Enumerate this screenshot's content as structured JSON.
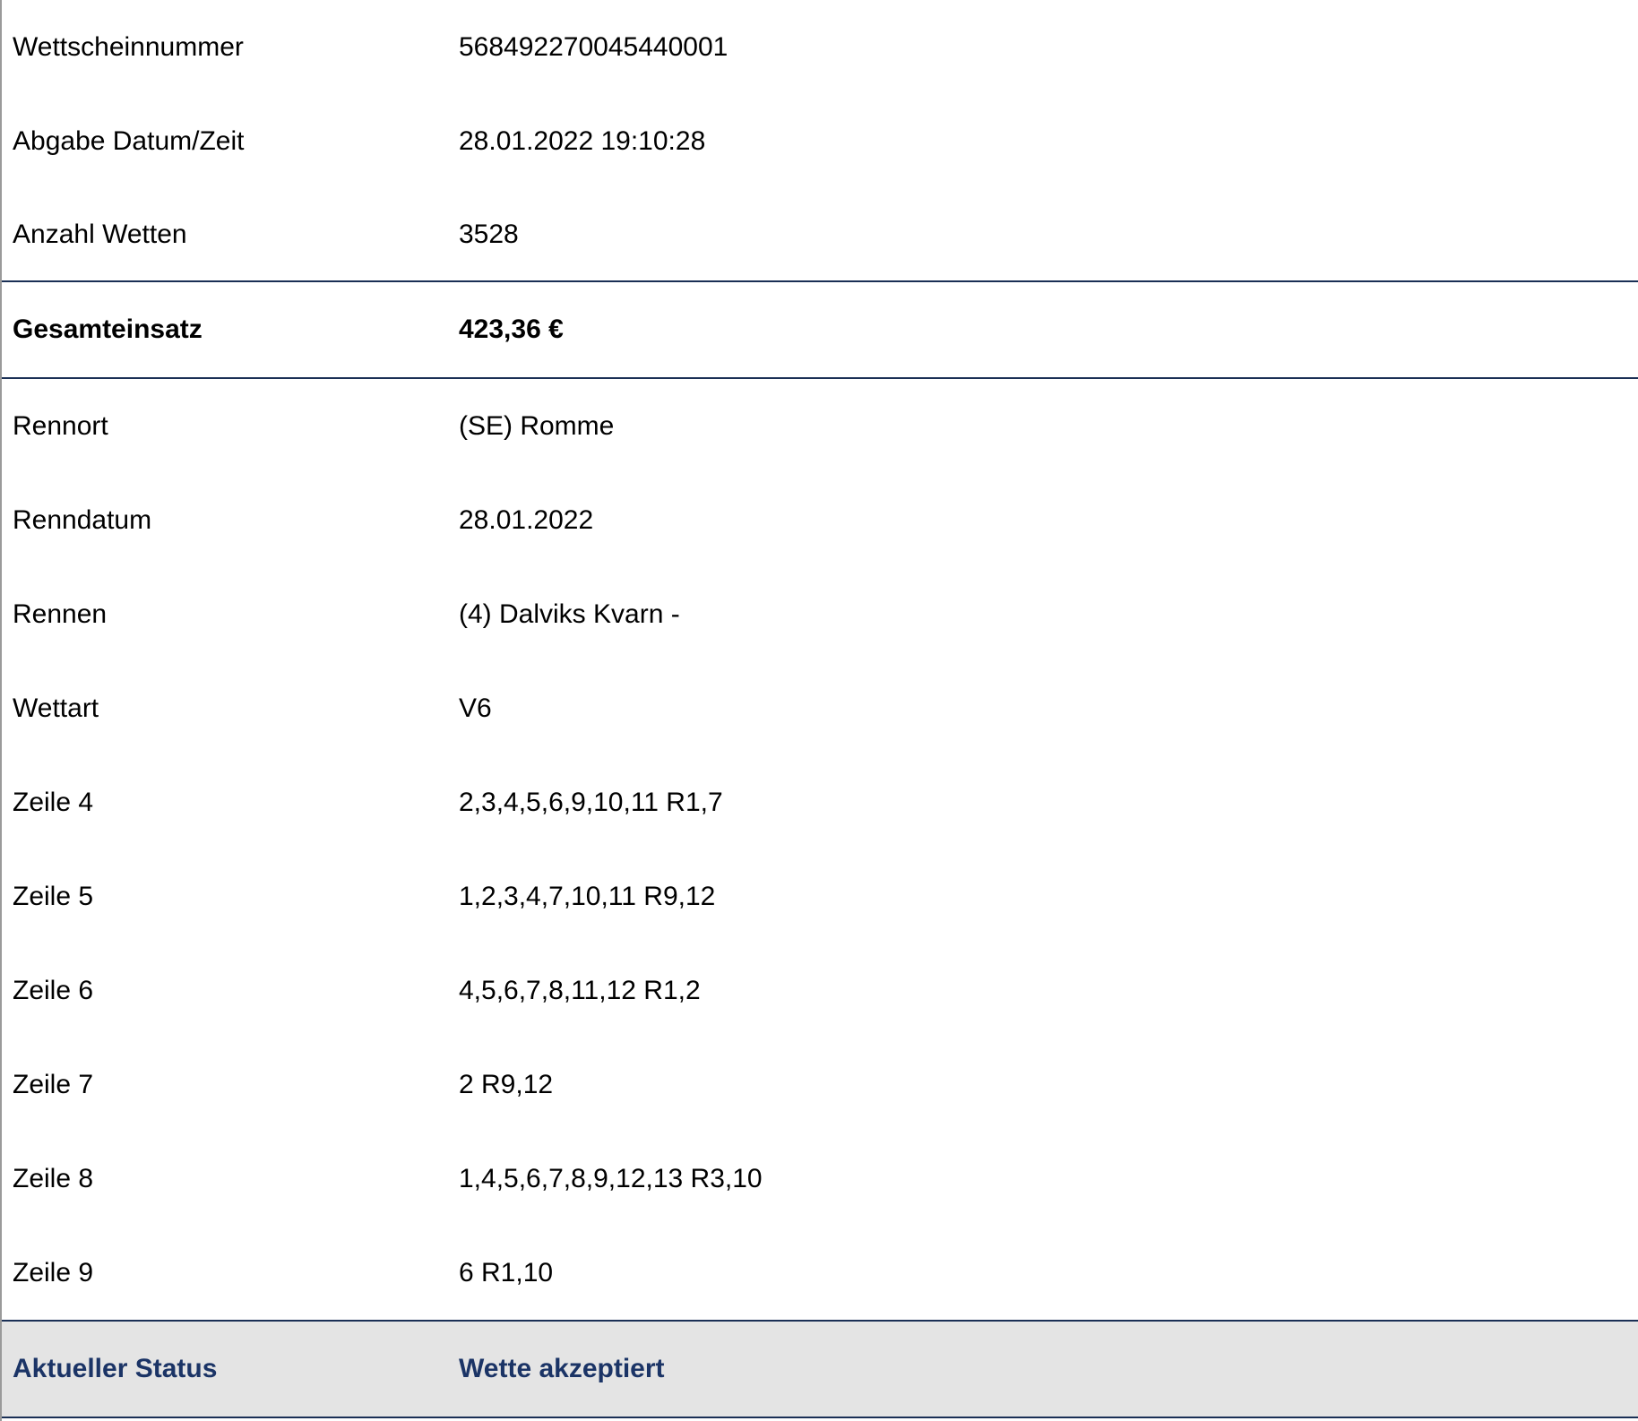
{
  "header_rows": [
    {
      "label": "Wettscheinnummer",
      "value": "568492270045440001"
    },
    {
      "label": "Abgabe Datum/Zeit",
      "value": "28.01.2022 19:10:28"
    },
    {
      "label": "Anzahl Wetten",
      "value": "3528"
    }
  ],
  "total": {
    "label": "Gesamteinsatz",
    "value": "423,36 €"
  },
  "detail_rows": [
    {
      "label": "Rennort",
      "value": "(SE) Romme"
    },
    {
      "label": "Renndatum",
      "value": "28.01.2022"
    },
    {
      "label": "Rennen",
      "value": "(4) Dalviks Kvarn -"
    },
    {
      "label": "Wettart",
      "value": "V6"
    },
    {
      "label": "Zeile 4",
      "value": "2,3,4,5,6,9,10,11 R1,7"
    },
    {
      "label": "Zeile 5",
      "value": "1,2,3,4,7,10,11 R9,12"
    },
    {
      "label": "Zeile 6",
      "value": "4,5,6,7,8,11,12 R1,2"
    },
    {
      "label": "Zeile 7",
      "value": "2 R9,12"
    },
    {
      "label": "Zeile 8",
      "value": "1,4,5,6,7,8,9,12,13 R3,10"
    },
    {
      "label": "Zeile 9",
      "value": "6 R1,10"
    }
  ],
  "status": {
    "label": "Aktueller Status",
    "value": "Wette akzeptiert"
  },
  "colors": {
    "accent": "#1b3466",
    "rule": "#1a2f55",
    "status_bg": "#e4e4e4"
  }
}
